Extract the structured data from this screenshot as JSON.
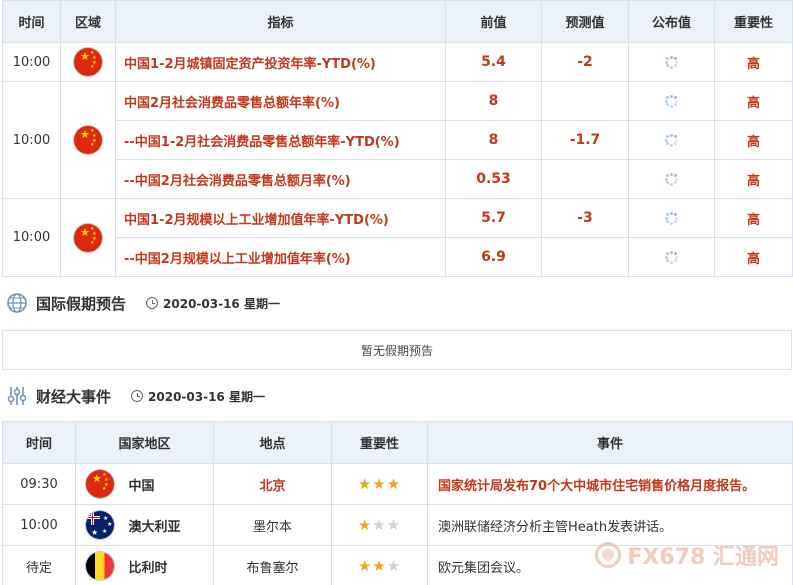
{
  "econ_table": {
    "headers": [
      "时间",
      "区域",
      "指标",
      "前值",
      "预测值",
      "公布值",
      "重要性"
    ],
    "rows": [
      {
        "time": "10:00",
        "indicator": "中国1-2月城镇固定资产投资年率-YTD(%)",
        "prev": "5.4",
        "forecast": "-2",
        "importance": "高"
      },
      {
        "time": "10:00",
        "indicator": "中国2月社会消费品零售总额年率(%)",
        "prev": "8",
        "forecast": "",
        "importance": "高"
      },
      {
        "time": "",
        "indicator": "--中国1-2月社会消费品零售总额年率-YTD(%)",
        "prev": "8",
        "forecast": "-1.7",
        "importance": "高"
      },
      {
        "time": "",
        "indicator": "--中国2月社会消费品零售总额月率(%)",
        "prev": "0.53",
        "forecast": "",
        "importance": "高"
      },
      {
        "time": "10:00",
        "indicator": "中国1-2月规模以上工业增加值年率-YTD(%)",
        "prev": "5.7",
        "forecast": "-3",
        "importance": "高"
      },
      {
        "time": "",
        "indicator": "--中国2月规模以上工业增加值年率(%)",
        "prev": "6.9",
        "forecast": "",
        "importance": "高"
      }
    ]
  },
  "holiday": {
    "title": "国际假期预告",
    "date": "2020-03-16 星期一",
    "empty_text": "暂无假期预告"
  },
  "events": {
    "title": "财经大事件",
    "date": "2020-03-16 星期一",
    "headers": [
      "时间",
      "国家地区",
      "地点",
      "重要性",
      "事件"
    ],
    "rows": [
      {
        "time": "09:30",
        "country": "中国",
        "location": "北京",
        "stars": 3,
        "event": "国家统计局发布70个大中城市住宅销售价格月度报告。"
      },
      {
        "time": "10:00",
        "country": "澳大利亚",
        "location": "墨尔本",
        "stars": 1,
        "event": "澳洲联储经济分析主管Heath发表讲话。"
      },
      {
        "time": "待定",
        "country": "比利时",
        "location": "布鲁塞尔",
        "stars": 2,
        "event": "欧元集团会议。"
      }
    ]
  },
  "watermark": "FX678 汇通网",
  "colors": {
    "highlight": "#c0391b",
    "header_bg": "#eaf1f8",
    "border": "#d7e1ec",
    "star": "#f0a818"
  },
  "icons": {
    "flag_china": "china-flag-icon",
    "flag_australia": "australia-flag-icon",
    "flag_belgium": "belgium-flag-icon",
    "pending": "loading-spinner-icon",
    "globe": "globe-icon",
    "sliders": "sliders-icon",
    "clock": "clock-icon"
  }
}
